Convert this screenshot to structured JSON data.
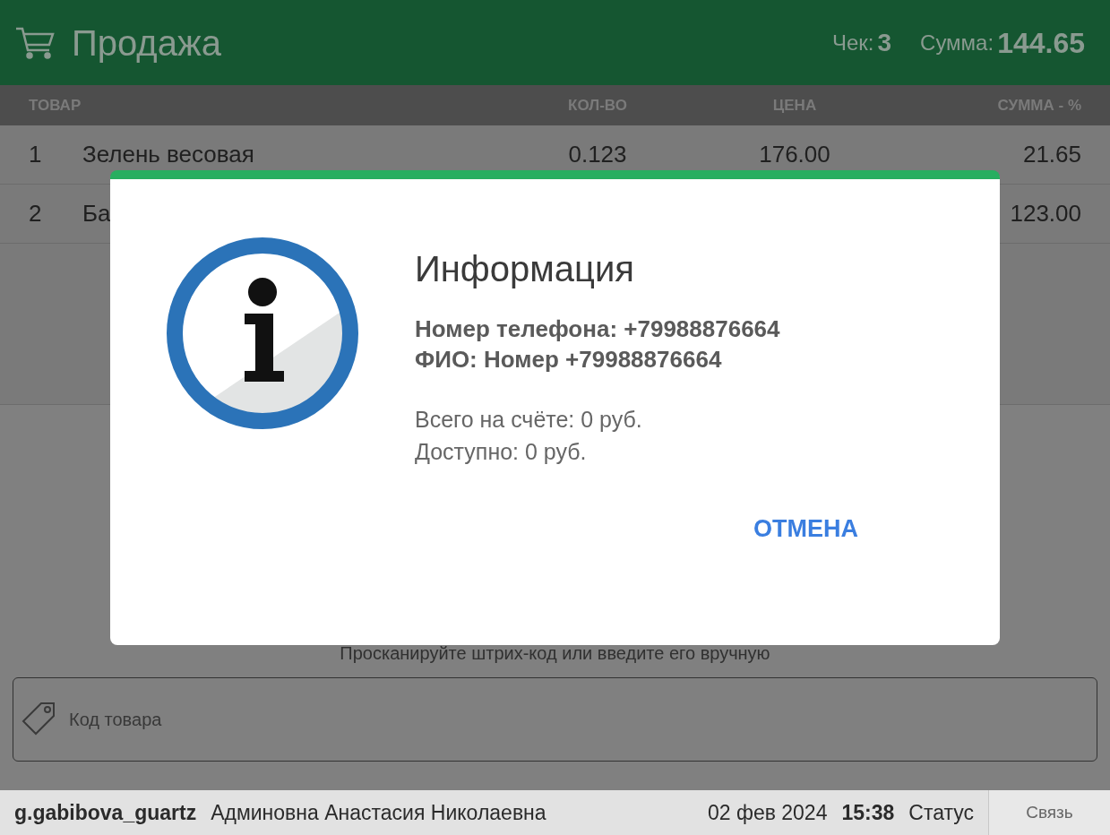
{
  "header": {
    "title": "Продажа",
    "receipt_label": "Чек:",
    "receipt_number": "3",
    "total_label": "Сумма:",
    "total_value": "144.65"
  },
  "table": {
    "columns": [
      "ТОВАР",
      "КОЛ-ВО",
      "ЦЕНА",
      "СУММА - %"
    ],
    "rows": [
      {
        "number": "1",
        "name": "Зелень весовая",
        "quantity": "0.123",
        "price": "176.00",
        "sum": "21.65"
      },
      {
        "number": "2",
        "name": "Ба",
        "sum": "123.00"
      }
    ]
  },
  "hint": "Просканируйте штрих-код или введите его вручную",
  "code_field": {
    "placeholder": "Код товара"
  },
  "dialog": {
    "title": "Информация",
    "details": [
      "Номер телефона: +79988876664",
      "ФИО: Номер +79988876664"
    ],
    "balance": [
      "Всего на счёте: 0 руб.",
      "Доступно: 0 руб."
    ],
    "button": "ОТМЕНА"
  },
  "status_bar": {
    "login": "g.gabibova_guartz",
    "user_name": "Админовна Анастасия Николаевна",
    "date": "02 фев 2024",
    "time": "15:38",
    "status": "Статус",
    "connection": "Связь"
  }
}
